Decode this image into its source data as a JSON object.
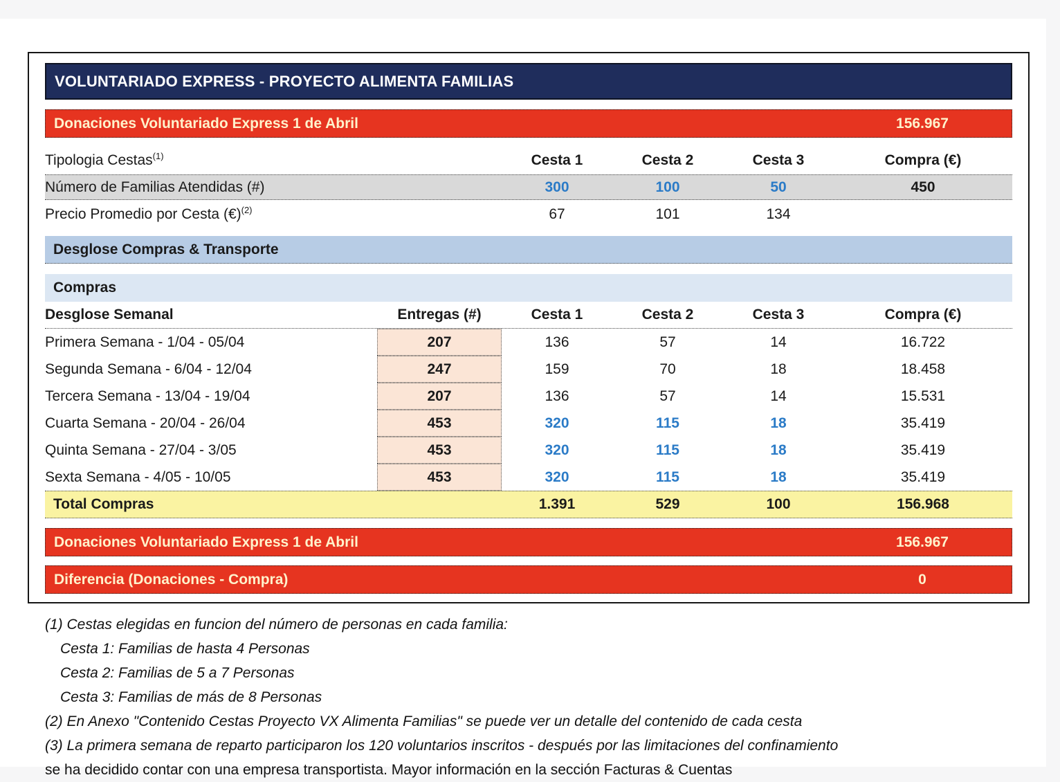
{
  "title": "VOLUNTARIADO EXPRESS - PROYECTO ALIMENTA FAMILIAS",
  "donaciones_top": {
    "label": "Donaciones Voluntariado Express 1 de Abril",
    "value": "156.967"
  },
  "tipologia": {
    "label": "Tipologia Cestas",
    "sup": "(1)",
    "col1": "Cesta 1",
    "col2": "Cesta 2",
    "col3": "Cesta 3",
    "col4": "Compra (€)"
  },
  "familias": {
    "label": "Número de Familias Atendidas (#)",
    "c1": "300",
    "c2": "100",
    "c3": "50",
    "total": "450"
  },
  "precio": {
    "label": "Precio Promedio por Cesta (€)",
    "sup": "(2)",
    "c1": "67",
    "c2": "101",
    "c3": "134"
  },
  "section_desglose": "Desglose Compras & Transporte",
  "section_compras": "Compras",
  "weekly": {
    "header": {
      "label": "Desglose Semanal",
      "entregas": "Entregas (#)",
      "col1": "Cesta 1",
      "col2": "Cesta 2",
      "col3": "Cesta 3",
      "col4": "Compra (€)"
    },
    "rows": [
      {
        "label": "Primera Semana - 1/04 - 05/04",
        "entregas": "207",
        "c1": "136",
        "c2": "57",
        "c3": "14",
        "compra": "16.722"
      },
      {
        "label": "Segunda Semana - 6/04 - 12/04",
        "entregas": "247",
        "c1": "159",
        "c2": "70",
        "c3": "18",
        "compra": "18.458"
      },
      {
        "label": "Tercera Semana - 13/04 - 19/04",
        "entregas": "207",
        "c1": "136",
        "c2": "57",
        "c3": "14",
        "compra": "15.531"
      },
      {
        "label": "Cuarta Semana - 20/04 - 26/04",
        "entregas": "453",
        "c1": "320",
        "c2": "115",
        "c3": "18",
        "compra": "35.419"
      },
      {
        "label": "Quinta Semana - 27/04 - 3/05",
        "entregas": "453",
        "c1": "320",
        "c2": "115",
        "c3": "18",
        "compra": "35.419"
      },
      {
        "label": "Sexta Semana - 4/05 - 10/05",
        "entregas": "453",
        "c1": "320",
        "c2": "115",
        "c3": "18",
        "compra": "35.419"
      }
    ],
    "total": {
      "label": "Total Compras",
      "c1": "1.391",
      "c2": "529",
      "c3": "100",
      "compra": "156.968"
    }
  },
  "donaciones_bottom": {
    "label": "Donaciones Voluntariado Express 1 de Abril",
    "value": "156.967"
  },
  "diferencia": {
    "label": "Diferencia (Donaciones - Compra)",
    "value": "0"
  },
  "footnotes": [
    {
      "text": "(1) Cestas elegidas en funcion del número de personas en cada familia:"
    },
    {
      "text": "Cesta 1: Familias de hasta 4 Personas"
    },
    {
      "text": "Cesta 2: Familias de 5 a 7 Personas"
    },
    {
      "text": "Cesta 3: Familias de más de 8 Personas"
    },
    {
      "text": "(2) En Anexo \"Contenido Cestas Proyecto VX Alimenta Familias\" se puede ver un detalle del contenido de cada cesta"
    },
    {
      "text": "(3) La primera semana de reparto participaron los 120 voluntarios inscritos - después por las limitaciones del confinamiento"
    },
    {
      "text": "se ha decidido contar con una empresa transportista. Mayor información en la sección Facturas & Cuentas"
    }
  ],
  "colors": {
    "navy": "#1F2D5C",
    "red": "#E63420",
    "cream_text": "#FFF2CC",
    "grey_row": "#D9D9D9",
    "blue_section": "#B7CCE5",
    "blue_section_light": "#DCE7F3",
    "peach_cell": "#FBE5D6",
    "yellow_total": "#FAF3A2",
    "value_blue": "#2B7BC7"
  }
}
